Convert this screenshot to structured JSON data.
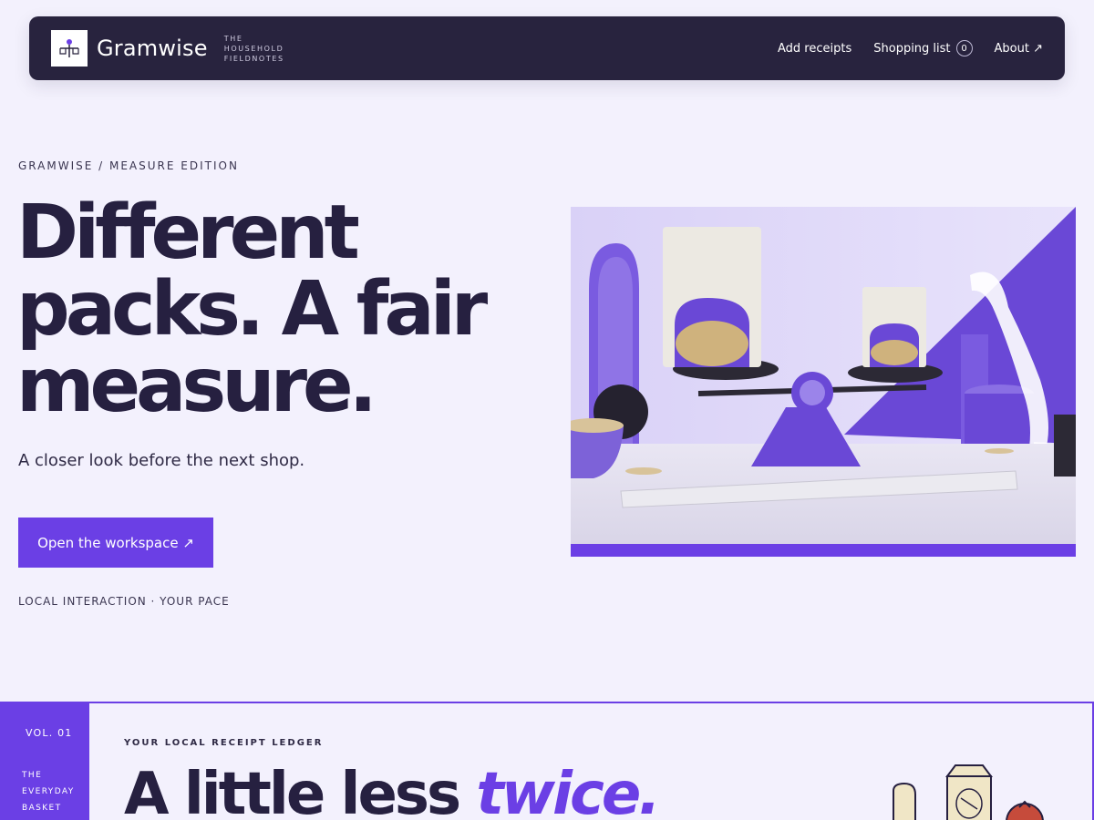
{
  "nav": {
    "brand": "Gramwise",
    "tagline": [
      "THE",
      "HOUSEHOLD",
      "FIELDNOTES"
    ],
    "links": {
      "add_receipts": "Add receipts",
      "shopping_list": "Shopping list",
      "shopping_count": "0",
      "about": "About ↗"
    }
  },
  "hero": {
    "kicker": "GRAMWISE / MEASURE EDITION",
    "title_lines": [
      "Different",
      "packs. A fair",
      "measure."
    ],
    "subtitle": "A closer look before the next shop.",
    "cta_label": "Open the workspace ↗",
    "footnote": "LOCAL INTERACTION · YOUR PACE"
  },
  "section": {
    "vol": "VOL. 01",
    "vol_label": [
      "THE",
      "EVERYDAY",
      "BASKET"
    ],
    "kicker": "YOUR LOCAL RECEIPT LEDGER",
    "title_plain": "A little less ",
    "title_accent": "twice."
  },
  "colors": {
    "accent": "#6b3fe5",
    "navy": "#28233e",
    "background": "#f3f1fd"
  },
  "icons": {
    "logo": "balance-scale-icon",
    "external": "arrow-up-right-icon"
  }
}
